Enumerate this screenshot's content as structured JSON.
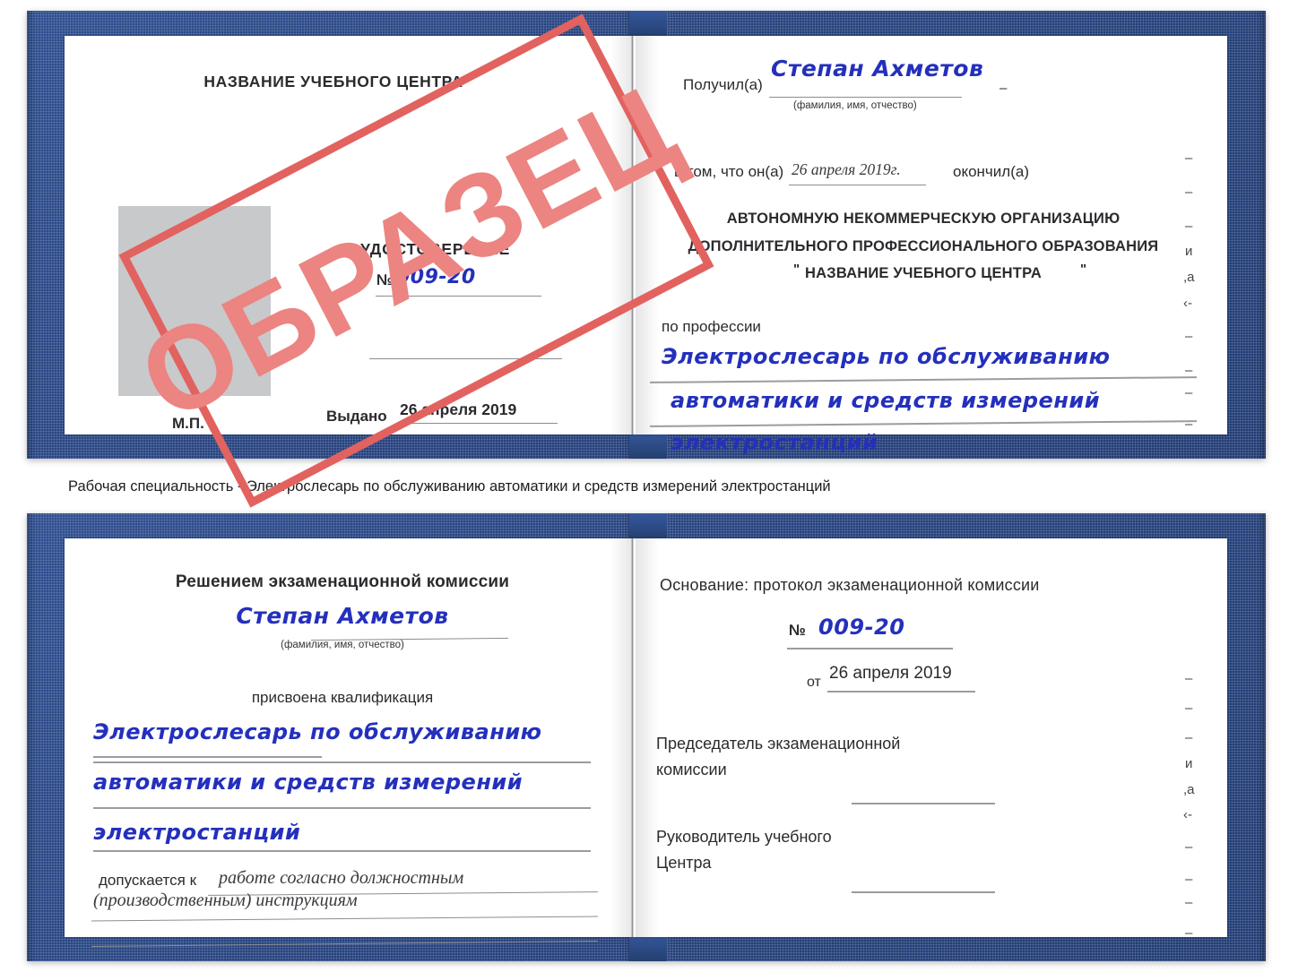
{
  "colors": {
    "cover_blue": "#27437f",
    "handwriting_blue": "#2430bc",
    "stamp_red_border": "#e2625f",
    "stamp_red_text": "#ec8481",
    "photo_placeholder_gray": "#c8c9cb",
    "rule_gray": "#8b8d91"
  },
  "caption": {
    "text": "Рабочая специальность - Электрослесарь по обслуживанию автоматики и средств измерений электростанций"
  },
  "watermark": {
    "text": "ОБРАЗЕЦ"
  },
  "certificate_1": {
    "left_page": {
      "center_name": "НАЗВАНИЕ УЧЕБНОГО ЦЕНТРА",
      "doc_type": "УДОСТОВЕРЕНИЕ",
      "number_label": "№",
      "number_value": "009-20",
      "issued_label": "Выдано",
      "issued_value": "26 апреля 2019",
      "seal_label": "М.П."
    },
    "right_page": {
      "received_label": "Получил(а)",
      "received_value": "Степан Ахметов",
      "fio_hint": "(фамилия, имя, отчество)",
      "in_that_label": "в том, что он(а)",
      "completion_date": "26 апреля 2019г.",
      "finished_label": "окончил(а)",
      "org_line_1": "АВТОНОМНУЮ НЕКОММЕРЧЕСКУЮ ОРГАНИЗАЦИЮ",
      "org_line_2": "ДОПОЛНИТЕЛЬНОГО ПРОФЕССИОНАЛЬНОГО ОБРАЗОВАНИЯ",
      "org_quote_open": "\"",
      "org_line_3": "НАЗВАНИЕ УЧЕБНОГО ЦЕНТРА",
      "org_quote_close": "\"",
      "profession_label": "по профессии",
      "profession_line_1": "Электрослесарь по обслуживанию",
      "profession_line_2": "автоматики и средств измерений",
      "profession_line_3": "электростанций",
      "edge_fragments": [
        "–",
        "–",
        "–",
        "и",
        ",а",
        "‹-",
        "–",
        "–",
        "–",
        "–"
      ]
    }
  },
  "certificate_2": {
    "left_page": {
      "heading": "Решением экзаменационной комиссии",
      "name_value": "Степан Ахметов",
      "fio_hint": "(фамилия, имя, отчество)",
      "qualification_label": "присвоена квалификация",
      "qualification_line_1": "Электрослесарь по обслуживанию",
      "qualification_line_2": "автоматики и средств измерений",
      "qualification_line_3": "электростанций",
      "admitted_label": "допускается к",
      "admitted_value_1": "работе согласно должностным",
      "admitted_value_2": "(производственным) инструкциям"
    },
    "right_page": {
      "basis_label": "Основание: протокол экзаменационной комиссии",
      "number_label": "№",
      "number_value": "009-20",
      "date_label": "от",
      "date_value": "26 апреля 2019",
      "chairman_line_1": "Председатель экзаменационной",
      "chairman_line_2": "комиссии",
      "head_line_1": "Руководитель учебного",
      "head_line_2": "Центра",
      "edge_fragments": [
        "–",
        "–",
        "–",
        "и",
        ",а",
        "‹-",
        "–",
        "–",
        "–",
        "–"
      ]
    }
  }
}
